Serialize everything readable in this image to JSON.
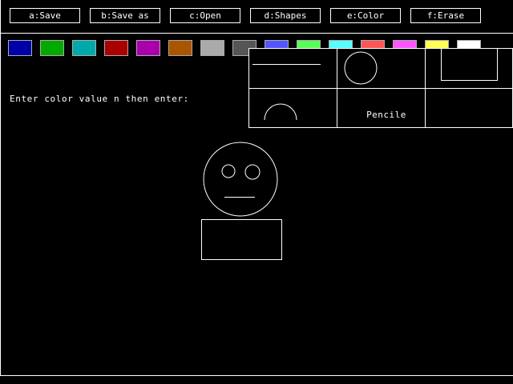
{
  "menu": {
    "save": "a:Save",
    "save_as": "b:Save as",
    "open": "c:Open",
    "shapes": "d:Shapes",
    "color": "e:Color",
    "erase": "f:Erase"
  },
  "palette": [
    {
      "name": "blue",
      "color": "#0000aa"
    },
    {
      "name": "green",
      "color": "#00aa00"
    },
    {
      "name": "cyan",
      "color": "#00aaaa"
    },
    {
      "name": "red",
      "color": "#aa0000"
    },
    {
      "name": "magenta",
      "color": "#aa00aa"
    },
    {
      "name": "brown",
      "color": "#aa5500"
    },
    {
      "name": "light-gray",
      "color": "#aaaaaa"
    },
    {
      "name": "dark-gray",
      "color": "#555555"
    },
    {
      "name": "light-blue",
      "color": "#5555ff"
    },
    {
      "name": "light-green",
      "color": "#55ff55"
    },
    {
      "name": "light-cyan",
      "color": "#55ffff"
    },
    {
      "name": "light-red",
      "color": "#ff5555"
    },
    {
      "name": "light-magenta",
      "color": "#ff55ff"
    },
    {
      "name": "yellow",
      "color": "#ffff55"
    },
    {
      "name": "white",
      "color": "#ffffff"
    }
  ],
  "prompt": "Enter color value n then enter:",
  "shapes_panel": {
    "pencil_label": "Pencile",
    "tools": [
      "line",
      "circle",
      "rectangle",
      "arc",
      "pencil",
      "empty"
    ]
  }
}
